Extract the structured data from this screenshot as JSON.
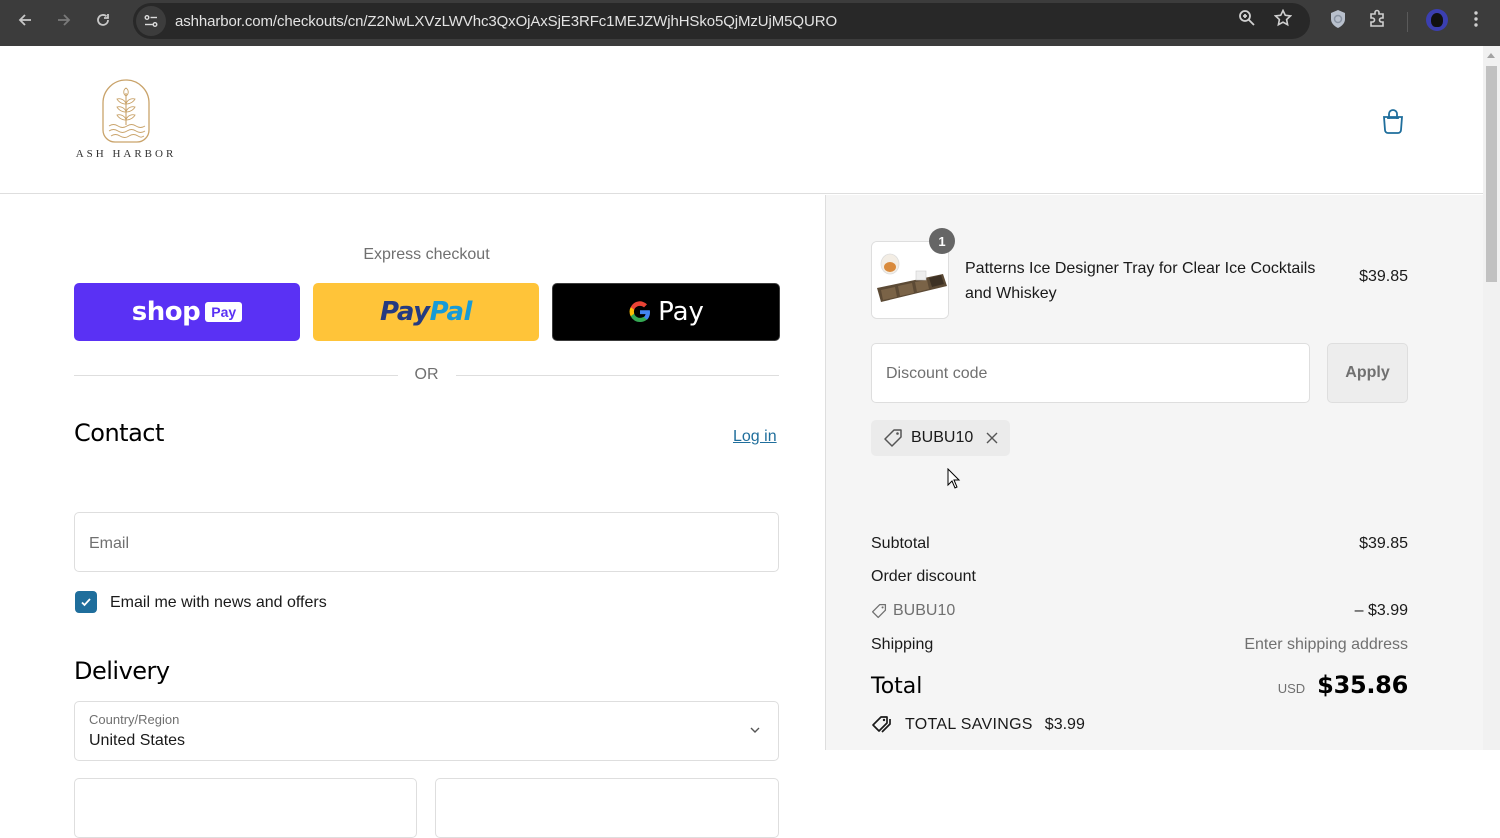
{
  "browser": {
    "url": "ashharbor.com/checkouts/cn/Z2NwLXVzLWVhc3QxOjAxSjE3RFc1MEJZWjhHSko5QjMzUjM5QURO",
    "icons": [
      "back-icon",
      "forward-icon",
      "reload-icon",
      "site-info-icon",
      "zoom-icon",
      "bookmark-star-icon",
      "shield-extension-icon",
      "extensions-puzzle-icon",
      "profile-avatar",
      "menu-dots-icon"
    ]
  },
  "header": {
    "brand": "ASH HARBOR",
    "cart_icon": "shopping-bag-icon",
    "brand_color": "#c9a36a",
    "accent_color": "#1f6e9c"
  },
  "express": {
    "title": "Express checkout",
    "buttons": [
      {
        "name": "Shop Pay",
        "word": "shop",
        "badge": "Pay",
        "color": "#5a31f4"
      },
      {
        "name": "PayPal",
        "part1": "Pay",
        "part2": "Pal",
        "color": "#ffc439"
      },
      {
        "name": "Google Pay",
        "label": "Pay",
        "color": "#000000"
      }
    ],
    "divider": "OR"
  },
  "contact": {
    "title": "Contact",
    "login_link": "Log in",
    "email_placeholder": "Email",
    "newsletter_label": "Email me with news and offers",
    "newsletter_checked": true
  },
  "delivery": {
    "title": "Delivery",
    "country_label": "Country/Region",
    "country_value": "United States"
  },
  "order": {
    "item": {
      "name": "Patterns Ice Designer Tray for Clear Ice Cocktails and Whiskey",
      "price": "$39.85",
      "quantity": "1"
    },
    "discount_placeholder": "Discount code",
    "apply_label": "Apply",
    "applied_code": "BUBU10",
    "subtotal_label": "Subtotal",
    "subtotal_value": "$39.85",
    "order_discount_label": "Order discount",
    "discount_code_line": "BUBU10",
    "discount_value": "– $3.99",
    "shipping_label": "Shipping",
    "shipping_value": "Enter shipping address",
    "total_label": "Total",
    "currency": "USD",
    "total_value": "$35.86",
    "savings_label": "TOTAL SAVINGS",
    "savings_value": "$3.99"
  }
}
